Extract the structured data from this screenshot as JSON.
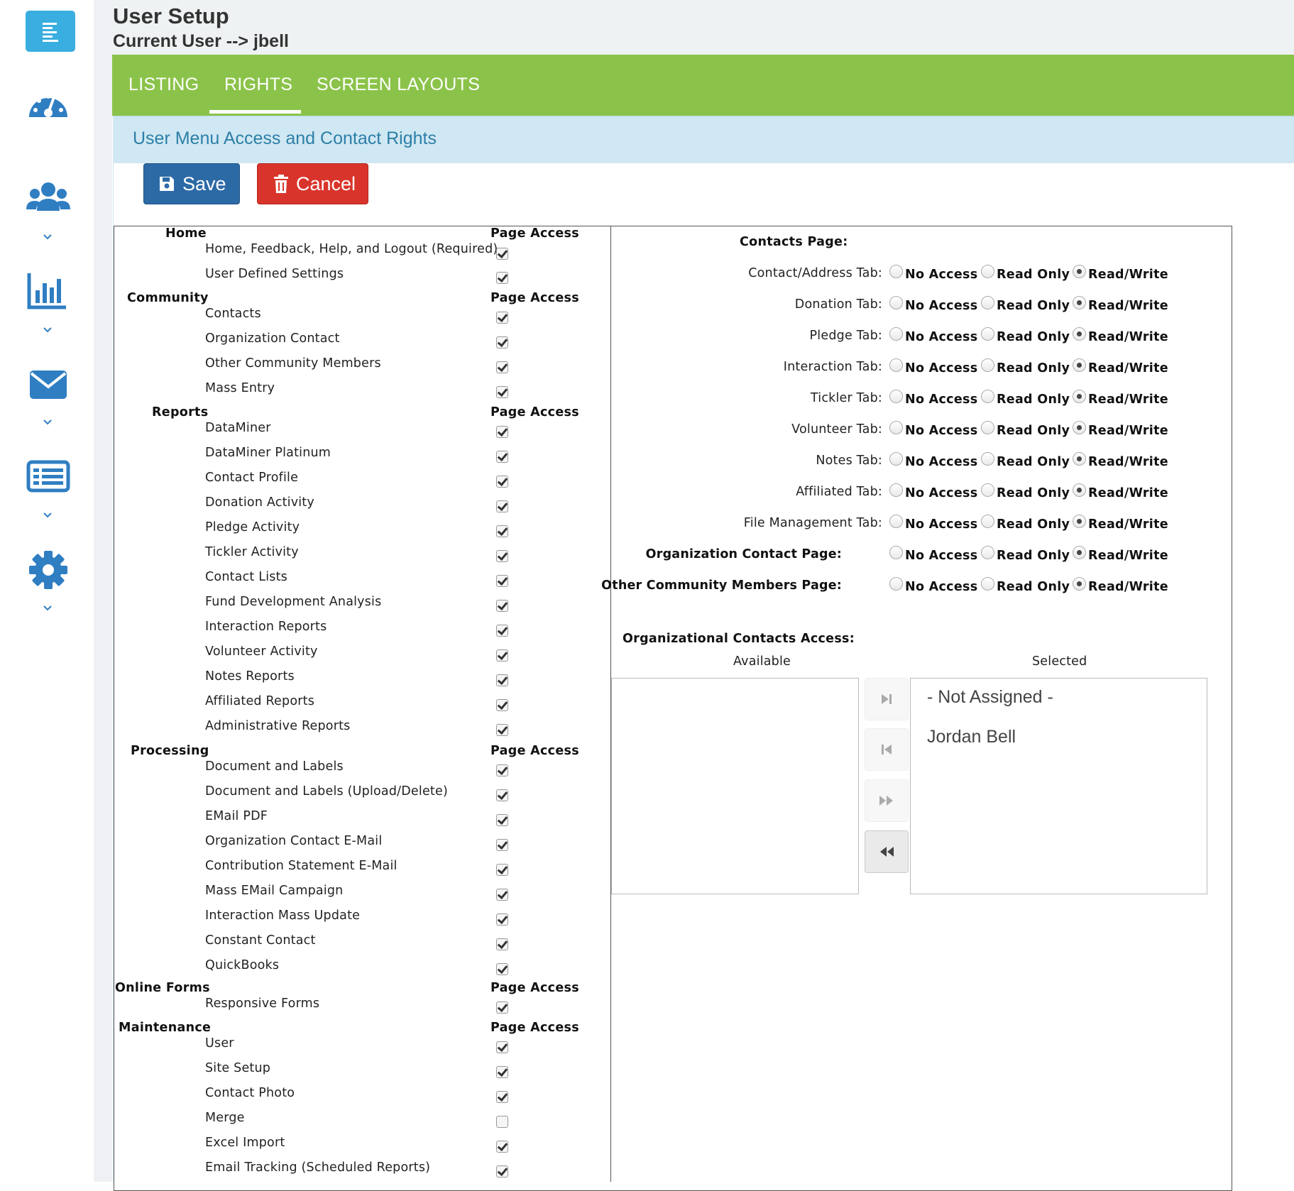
{
  "header": {
    "title": "User Setup",
    "current_user": "Current User --> jbell"
  },
  "tabs": [
    {
      "label": "LISTING",
      "active": false
    },
    {
      "label": "RIGHTS",
      "active": true
    },
    {
      "label": "SCREEN LAYOUTS",
      "active": false
    }
  ],
  "section_title": "User Menu Access and Contact Rights",
  "actions": {
    "save_label": "Save",
    "cancel_label": "Cancel"
  },
  "page_access_header": "Page Access",
  "groups": [
    {
      "name": "Home",
      "items": [
        {
          "label": "Home, Feedback, Help, and Logout (Required)",
          "checked": true
        },
        {
          "label": "User Defined Settings",
          "checked": true
        }
      ]
    },
    {
      "name": "Community",
      "items": [
        {
          "label": "Contacts",
          "checked": true
        },
        {
          "label": "Organization Contact",
          "checked": true
        },
        {
          "label": "Other Community Members",
          "checked": true
        },
        {
          "label": "Mass Entry",
          "checked": true
        }
      ]
    },
    {
      "name": "Reports",
      "items": [
        {
          "label": "DataMiner",
          "checked": true
        },
        {
          "label": "DataMiner Platinum",
          "checked": true
        },
        {
          "label": "Contact Profile",
          "checked": true
        },
        {
          "label": "Donation Activity",
          "checked": true
        },
        {
          "label": "Pledge Activity",
          "checked": true
        },
        {
          "label": "Tickler Activity",
          "checked": true
        },
        {
          "label": "Contact Lists",
          "checked": true
        },
        {
          "label": "Fund Development Analysis",
          "checked": true
        },
        {
          "label": "Interaction Reports",
          "checked": true
        },
        {
          "label": "Volunteer Activity",
          "checked": true
        },
        {
          "label": "Notes Reports",
          "checked": true
        },
        {
          "label": "Affiliated Reports",
          "checked": true
        },
        {
          "label": "Administrative Reports",
          "checked": true
        }
      ]
    },
    {
      "name": "Processing",
      "items": [
        {
          "label": "Document and Labels",
          "checked": true
        },
        {
          "label": "Document and Labels (Upload/Delete)",
          "checked": true
        },
        {
          "label": "EMail PDF",
          "checked": true
        },
        {
          "label": "Organization Contact E-Mail",
          "checked": true
        },
        {
          "label": "Contribution Statement E-Mail",
          "checked": true
        },
        {
          "label": "Mass EMail Campaign",
          "checked": true
        },
        {
          "label": "Interaction Mass Update",
          "checked": true
        },
        {
          "label": "Constant Contact",
          "checked": true
        },
        {
          "label": "QuickBooks",
          "checked": true
        }
      ]
    },
    {
      "name": "Online Forms",
      "items": [
        {
          "label": "Responsive Forms",
          "checked": true
        }
      ]
    },
    {
      "name": "Maintenance",
      "items": [
        {
          "label": "User",
          "checked": true
        },
        {
          "label": "Site Setup",
          "checked": true
        },
        {
          "label": "Contact Photo",
          "checked": true
        },
        {
          "label": "Merge",
          "checked": false
        },
        {
          "label": "Excel Import",
          "checked": true
        },
        {
          "label": "Email Tracking (Scheduled Reports)",
          "checked": true
        }
      ]
    }
  ],
  "contacts_page": {
    "heading": "Contacts Page:",
    "options": [
      "No Access",
      "Read Only",
      "Read/Write"
    ],
    "rows": [
      {
        "label": "Contact/Address Tab:",
        "bold": false,
        "selected": "Read/Write"
      },
      {
        "label": "Donation Tab:",
        "bold": false,
        "selected": "Read/Write"
      },
      {
        "label": "Pledge Tab:",
        "bold": false,
        "selected": "Read/Write"
      },
      {
        "label": "Interaction Tab:",
        "bold": false,
        "selected": "Read/Write"
      },
      {
        "label": "Tickler Tab:",
        "bold": false,
        "selected": "Read/Write"
      },
      {
        "label": "Volunteer Tab:",
        "bold": false,
        "selected": "Read/Write"
      },
      {
        "label": "Notes Tab:",
        "bold": false,
        "selected": "Read/Write"
      },
      {
        "label": "Affiliated Tab:",
        "bold": false,
        "selected": "Read/Write"
      },
      {
        "label": "File Management Tab:",
        "bold": false,
        "selected": "Read/Write"
      },
      {
        "label": "Organization Contact Page:",
        "bold": true,
        "selected": "Read/Write"
      },
      {
        "label": "Other Community Members Page:",
        "bold": true,
        "selected": "Read/Write"
      }
    ]
  },
  "org_contacts": {
    "heading": "Organizational Contacts Access:",
    "available_label": "Available",
    "selected_label": "Selected",
    "available": [],
    "selected": [
      "- Not Assigned -",
      "Jordan Bell"
    ]
  },
  "sidebar_icons": [
    "menu-icon",
    "dashboard-icon",
    "users-icon",
    "reports-icon",
    "email-icon",
    "list-icon",
    "settings-icon"
  ],
  "colors": {
    "tabbar": "#8bc34a",
    "section_band": "#d0e8f3",
    "save": "#2c6aa6",
    "cancel": "#d9342b",
    "sidebar_icon": "#2f7ec2"
  }
}
